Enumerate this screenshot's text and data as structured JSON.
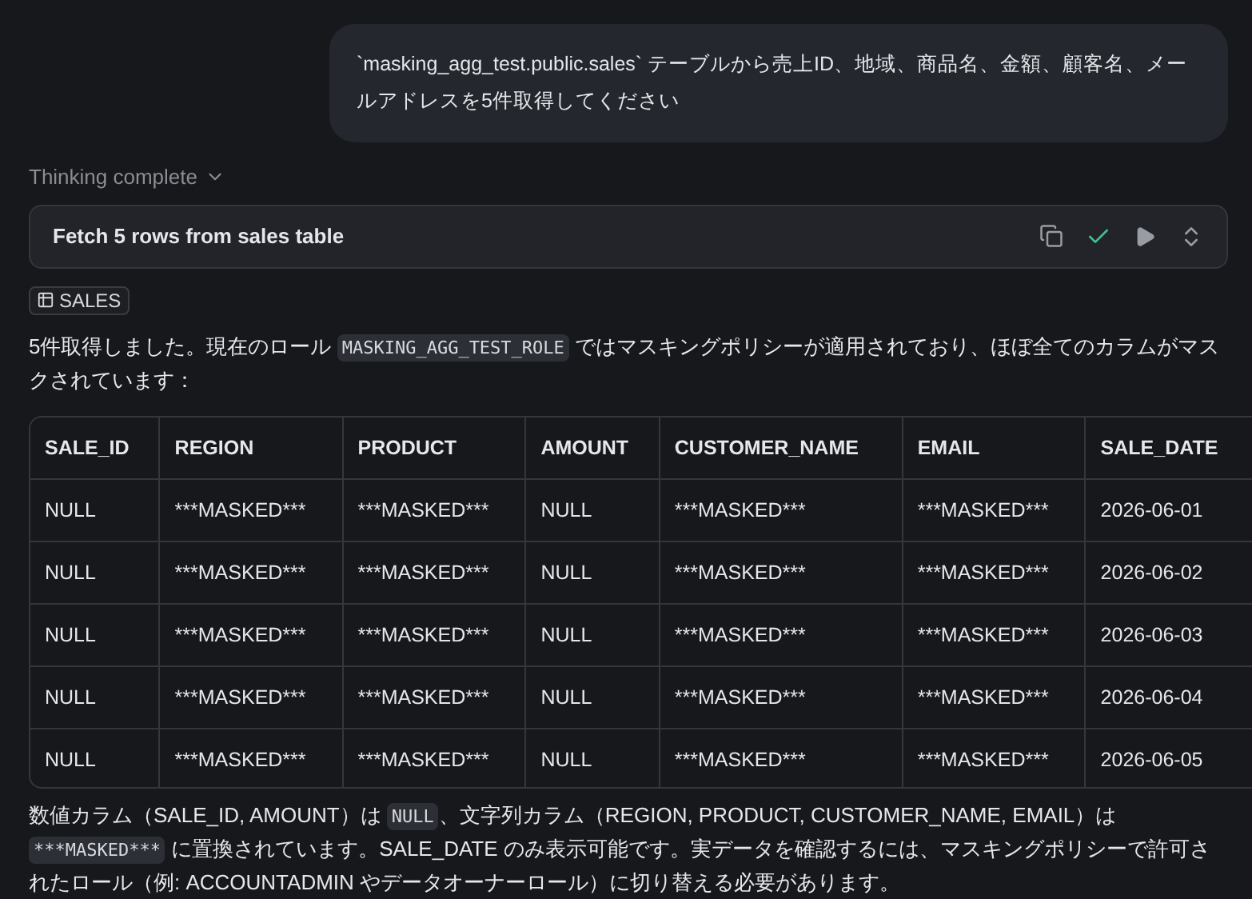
{
  "user_message": "`masking_agg_test.public.sales` テーブルから売上ID、地域、商品名、金額、顧客名、メールアドレスを5件取得してください",
  "thinking": {
    "label": "Thinking complete",
    "expanded": false
  },
  "tool_call": {
    "title": "Fetch 5 rows from sales table",
    "done": true
  },
  "tag": "SALES",
  "intro": [
    {
      "kind": "text",
      "text": "5件取得しました。現在のロール "
    },
    {
      "kind": "code",
      "text": "MASKING_AGG_TEST_ROLE"
    },
    {
      "kind": "text",
      "text": " ではマスキングポリシーが適用されており、ほぼ全てのカラムがマスクされています："
    }
  ],
  "table": {
    "columns": [
      "SALE_ID",
      "REGION",
      "PRODUCT",
      "AMOUNT",
      "CUSTOMER_NAME",
      "EMAIL",
      "SALE_DATE"
    ],
    "rows": [
      [
        "NULL",
        "***MASKED***",
        "***MASKED***",
        "NULL",
        "***MASKED***",
        "***MASKED***",
        "2026-06-01"
      ],
      [
        "NULL",
        "***MASKED***",
        "***MASKED***",
        "NULL",
        "***MASKED***",
        "***MASKED***",
        "2026-06-02"
      ],
      [
        "NULL",
        "***MASKED***",
        "***MASKED***",
        "NULL",
        "***MASKED***",
        "***MASKED***",
        "2026-06-03"
      ],
      [
        "NULL",
        "***MASKED***",
        "***MASKED***",
        "NULL",
        "***MASKED***",
        "***MASKED***",
        "2026-06-04"
      ],
      [
        "NULL",
        "***MASKED***",
        "***MASKED***",
        "NULL",
        "***MASKED***",
        "***MASKED***",
        "2026-06-05"
      ]
    ]
  },
  "summary": [
    {
      "kind": "text",
      "text": "数値カラム（SALE_ID, AMOUNT）は "
    },
    {
      "kind": "code",
      "text": "NULL"
    },
    {
      "kind": "text",
      "text": "、文字列カラム（REGION, PRODUCT, CUSTOMER_NAME, EMAIL）は "
    },
    {
      "kind": "code",
      "text": "***MASKED***"
    },
    {
      "kind": "text",
      "text": " に置換されています。SALE_DATE のみ表示可能です。実データを確認するには、マスキングポリシーで許可されたロール（例: ACCOUNTADMIN やデータオーナーロール）に切り替える必要があります。"
    }
  ]
}
